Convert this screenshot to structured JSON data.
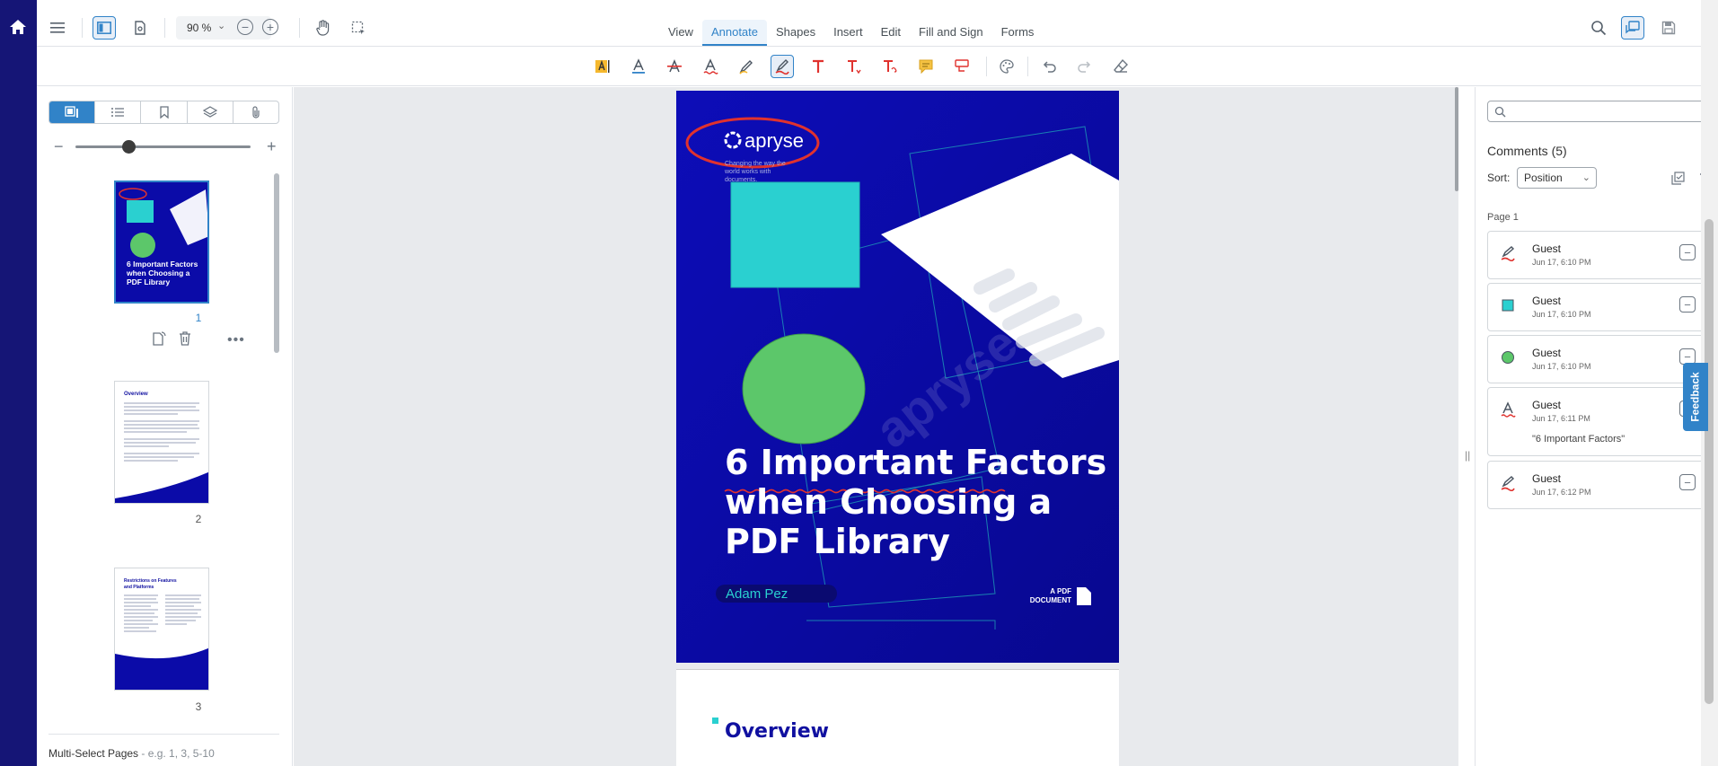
{
  "header": {
    "zoom_value": "90 %",
    "ribbons": [
      "View",
      "Annotate",
      "Shapes",
      "Insert",
      "Edit",
      "Fill and Sign",
      "Forms"
    ],
    "active_ribbon": "Annotate"
  },
  "left_panel": {
    "tabs": [
      "thumbnails-icon",
      "outline-icon",
      "bookmarks-icon",
      "layers-icon",
      "attachments-icon"
    ],
    "thumbnails": [
      {
        "page": "1",
        "title": "6 Important Factors when Choosing a PDF Library"
      },
      {
        "page": "2",
        "title": "Overview"
      },
      {
        "page": "3",
        "title": "Restrictions on Features and Platforms"
      }
    ],
    "multiselect_label": "Multi-Select Pages",
    "multiselect_hint": " - e.g. 1, 3, 5-10",
    "thumb_size_fraction": 0.3
  },
  "document": {
    "logo_text": "apryse",
    "tagline": "Changing the way the world works with documents.",
    "watermark": "apryse",
    "title_lines": [
      "6 Important Factors",
      "when Choosing a",
      "PDF Library"
    ],
    "author": "Adam Pez",
    "doc_label_1": "A PDF",
    "doc_label_2": "DOCUMENT",
    "page2_heading": "Overview",
    "colors": {
      "page_bg": "#0b0ba8",
      "square": "#2ad0d0",
      "circle": "#5cc76a",
      "ink": "#e0322e"
    }
  },
  "comments": {
    "title": "Comments (5)",
    "sort_label": "Sort:",
    "sort_value": "Position",
    "page_label": "Page 1",
    "items": [
      {
        "icon": "freehand-pen-icon",
        "author": "Guest",
        "date": "Jun 17, 6:10 PM",
        "contents": ""
      },
      {
        "icon": "rectangle-icon",
        "author": "Guest",
        "date": "Jun 17, 6:10 PM",
        "contents": ""
      },
      {
        "icon": "ellipse-icon",
        "author": "Guest",
        "date": "Jun 17, 6:10 PM",
        "contents": ""
      },
      {
        "icon": "squiggly-text-icon",
        "author": "Guest",
        "date": "Jun 17, 6:11 PM",
        "contents": "\"6 Important Factors\""
      },
      {
        "icon": "freehand-pen-icon",
        "author": "Guest",
        "date": "Jun 17, 6:12 PM",
        "contents": ""
      }
    ]
  },
  "feedback_label": "Feedback"
}
